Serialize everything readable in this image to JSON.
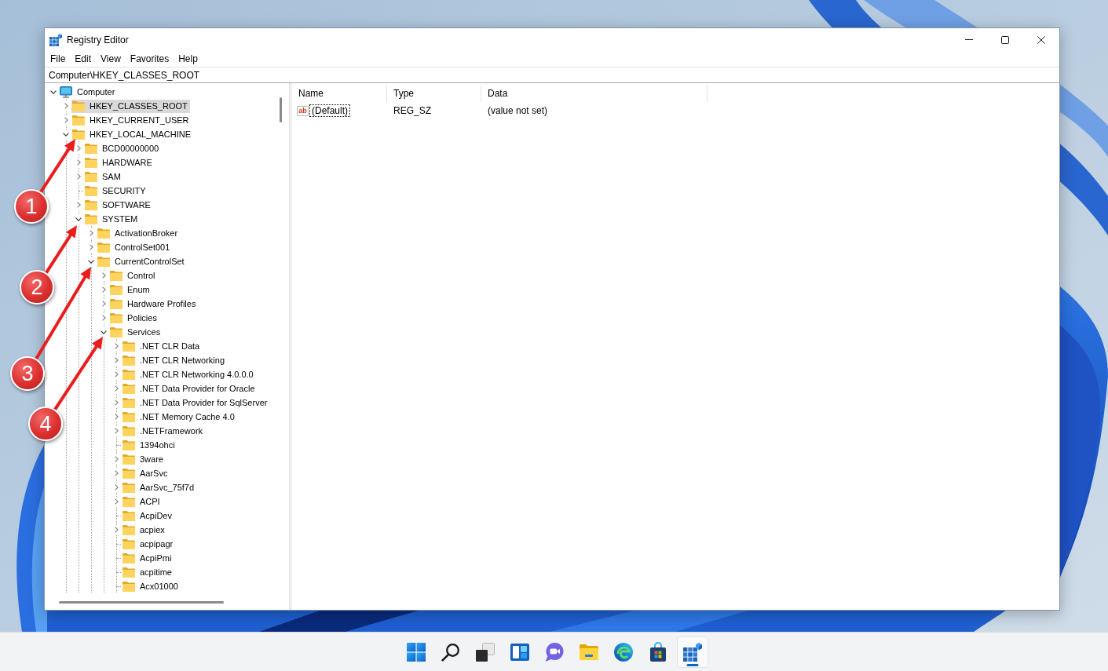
{
  "window": {
    "title": "Registry Editor"
  },
  "menu_bar": [
    "File",
    "Edit",
    "View",
    "Favorites",
    "Help"
  ],
  "address_bar": {
    "value": "Computer\\HKEY_CLASSES_ROOT"
  },
  "tree": {
    "items": [
      {
        "label": "Computer",
        "kind": "computer",
        "expanded": true,
        "selected": false,
        "children": [
          {
            "label": "HKEY_CLASSES_ROOT",
            "kind": "folder",
            "expanded": false,
            "selected": true
          },
          {
            "label": "HKEY_CURRENT_USER",
            "kind": "folder",
            "expanded": false,
            "selected": false
          },
          {
            "label": "HKEY_LOCAL_MACHINE",
            "kind": "folder",
            "expanded": true,
            "selected": false,
            "children": [
              {
                "label": "BCD00000000",
                "kind": "folder",
                "expanded": false,
                "selected": false
              },
              {
                "label": "HARDWARE",
                "kind": "folder",
                "expanded": false,
                "selected": false
              },
              {
                "label": "SAM",
                "kind": "folder",
                "expanded": false,
                "selected": false
              },
              {
                "label": "SECURITY",
                "kind": "folder",
                "selected": false
              },
              {
                "label": "SOFTWARE",
                "kind": "folder",
                "expanded": false,
                "selected": false
              },
              {
                "label": "SYSTEM",
                "kind": "folder",
                "expanded": true,
                "selected": false,
                "children": [
                  {
                    "label": "ActivationBroker",
                    "kind": "folder",
                    "expanded": false,
                    "selected": false
                  },
                  {
                    "label": "ControlSet001",
                    "kind": "folder",
                    "expanded": false,
                    "selected": false
                  },
                  {
                    "label": "CurrentControlSet",
                    "kind": "folder",
                    "expanded": true,
                    "selected": false,
                    "children": [
                      {
                        "label": "Control",
                        "kind": "folder",
                        "expanded": false,
                        "selected": false
                      },
                      {
                        "label": "Enum",
                        "kind": "folder",
                        "expanded": false,
                        "selected": false
                      },
                      {
                        "label": "Hardware Profiles",
                        "kind": "folder",
                        "expanded": false,
                        "selected": false
                      },
                      {
                        "label": "Policies",
                        "kind": "folder",
                        "expanded": false,
                        "selected": false
                      },
                      {
                        "label": "Services",
                        "kind": "folder",
                        "expanded": true,
                        "selected": false,
                        "children": [
                          {
                            "label": ".NET CLR Data",
                            "kind": "folder",
                            "expanded": false,
                            "selected": false
                          },
                          {
                            "label": ".NET CLR Networking",
                            "kind": "folder",
                            "expanded": false,
                            "selected": false
                          },
                          {
                            "label": ".NET CLR Networking 4.0.0.0",
                            "kind": "folder",
                            "expanded": false,
                            "selected": false
                          },
                          {
                            "label": ".NET Data Provider for Oracle",
                            "kind": "folder",
                            "expanded": false,
                            "selected": false
                          },
                          {
                            "label": ".NET Data Provider for SqlServer",
                            "kind": "folder",
                            "expanded": false,
                            "selected": false
                          },
                          {
                            "label": ".NET Memory Cache 4.0",
                            "kind": "folder",
                            "expanded": false,
                            "selected": false
                          },
                          {
                            "label": ".NETFramework",
                            "kind": "folder",
                            "expanded": false,
                            "selected": false
                          },
                          {
                            "label": "1394ohci",
                            "kind": "folder",
                            "selected": false
                          },
                          {
                            "label": "3ware",
                            "kind": "folder",
                            "expanded": false,
                            "selected": false
                          },
                          {
                            "label": "AarSvc",
                            "kind": "folder",
                            "expanded": false,
                            "selected": false
                          },
                          {
                            "label": "AarSvc_75f7d",
                            "kind": "folder",
                            "expanded": false,
                            "selected": false
                          },
                          {
                            "label": "ACPI",
                            "kind": "folder",
                            "expanded": false,
                            "selected": false
                          },
                          {
                            "label": "AcpiDev",
                            "kind": "folder",
                            "selected": false
                          },
                          {
                            "label": "acpiex",
                            "kind": "folder",
                            "expanded": false,
                            "selected": false
                          },
                          {
                            "label": "acpipagr",
                            "kind": "folder",
                            "selected": false
                          },
                          {
                            "label": "AcpiPmi",
                            "kind": "folder",
                            "selected": false
                          },
                          {
                            "label": "acpitime",
                            "kind": "folder",
                            "selected": false
                          },
                          {
                            "label": "Acx01000",
                            "kind": "folder",
                            "selected": false
                          }
                        ]
                      }
                    ]
                  }
                ]
              }
            ]
          }
        ]
      }
    ]
  },
  "values": {
    "columns": [
      "Name",
      "Type",
      "Data"
    ],
    "rows": [
      {
        "icon": "ab",
        "name": "(Default)",
        "type": "REG_SZ",
        "data": "(value not set)",
        "focused": true
      }
    ]
  },
  "annotations": [
    {
      "number": "1"
    },
    {
      "number": "2"
    },
    {
      "number": "3"
    },
    {
      "number": "4"
    }
  ],
  "taskbar": [
    {
      "kind": "start",
      "active": false
    },
    {
      "kind": "search",
      "active": false
    },
    {
      "kind": "task_view",
      "active": false
    },
    {
      "kind": "widgets",
      "active": false
    },
    {
      "kind": "chat",
      "active": false
    },
    {
      "kind": "file_explorer",
      "active": false
    },
    {
      "kind": "browser",
      "active": false
    },
    {
      "kind": "store",
      "active": false
    },
    {
      "kind": "registry_editor",
      "active": true
    }
  ]
}
